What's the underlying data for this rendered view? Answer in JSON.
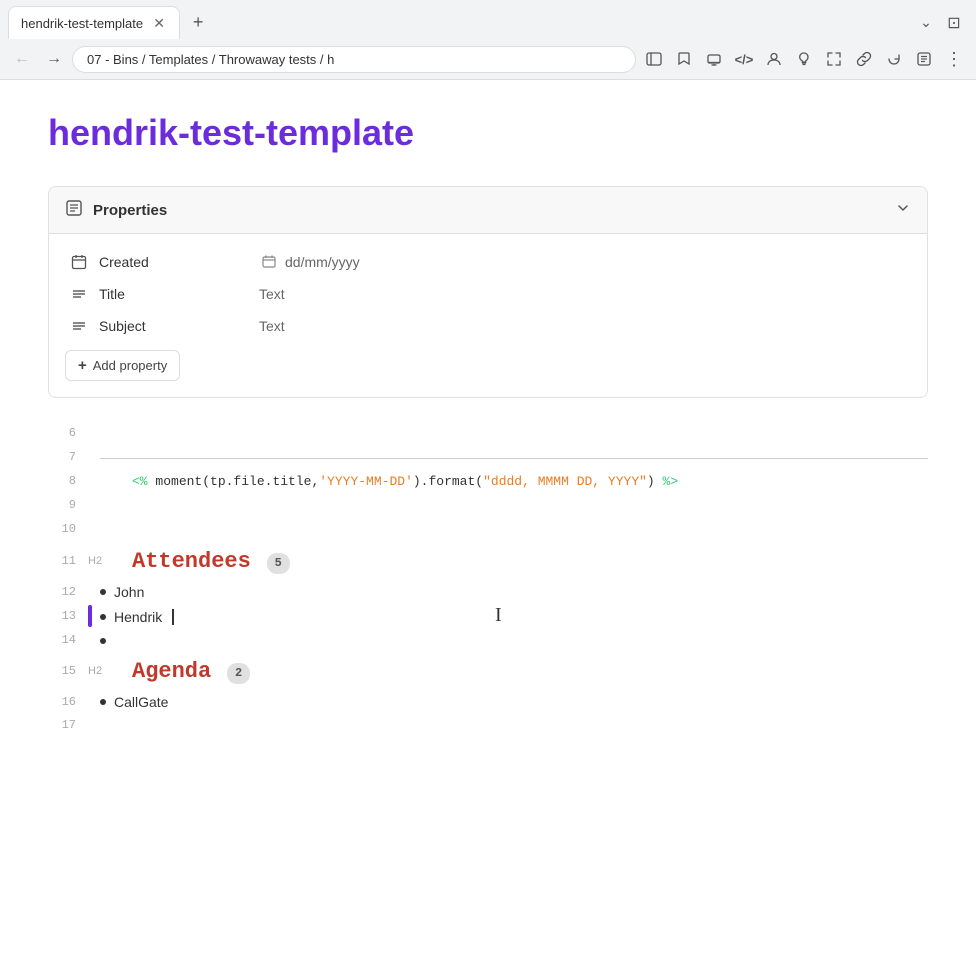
{
  "browser": {
    "tab_title": "hendrik-test-template",
    "tab_close_icon": "✕",
    "new_tab_icon": "+",
    "tab_end_icon": "⌄",
    "nav_back_icon": "←",
    "nav_forward_icon": "→",
    "address_path": "07 - Bins / Templates / Throwaway tests / h",
    "nav_icons": {
      "sidebar": "⊞",
      "bookmark": "☆",
      "cast": "⊡",
      "code": "</>",
      "person": "☺",
      "bulb": "💡",
      "fullscreen": "⛶",
      "link": "🔗",
      "refresh": "↻",
      "reader": "≡",
      "menu": "⋮"
    }
  },
  "page": {
    "title": "hendrik-test-template"
  },
  "properties": {
    "section_label": "Properties",
    "expand_icon": "⌄",
    "rows": [
      {
        "icon": "calendar",
        "name": "Created",
        "value": "dd/mm/yyyy"
      },
      {
        "icon": "lines",
        "name": "Title",
        "value": "Text"
      },
      {
        "icon": "lines",
        "name": "Subject",
        "value": "Text"
      }
    ],
    "add_btn_label": "Add property",
    "add_icon": "+"
  },
  "editor": {
    "lines": [
      {
        "num": "6",
        "type": "",
        "content_type": "empty"
      },
      {
        "num": "7",
        "type": "",
        "content_type": "hr"
      },
      {
        "num": "8",
        "type": "",
        "content_type": "code",
        "code": "<% moment(tp.file.title,'YYYY-MM-DD').format(\"dddd, MMMM DD, YYYY\") %>"
      },
      {
        "num": "9",
        "type": "",
        "content_type": "empty"
      },
      {
        "num": "10",
        "type": "",
        "content_type": "empty"
      },
      {
        "num": "11",
        "type": "H2",
        "content_type": "heading",
        "heading": "Attendees",
        "badge": "5"
      },
      {
        "num": "12",
        "type": "",
        "content_type": "bullet",
        "text": "John",
        "indicator": false
      },
      {
        "num": "13",
        "type": "",
        "content_type": "bullet",
        "text": "Hendrik",
        "indicator": true
      },
      {
        "num": "14",
        "type": "",
        "content_type": "bullet",
        "text": "",
        "indicator": false
      },
      {
        "num": "15",
        "type": "H2",
        "content_type": "heading",
        "heading": "Agenda",
        "badge": "2"
      },
      {
        "num": "16",
        "type": "",
        "content_type": "bullet",
        "text": "CallGate",
        "indicator": false
      },
      {
        "num": "17",
        "type": "",
        "content_type": "empty"
      }
    ]
  }
}
